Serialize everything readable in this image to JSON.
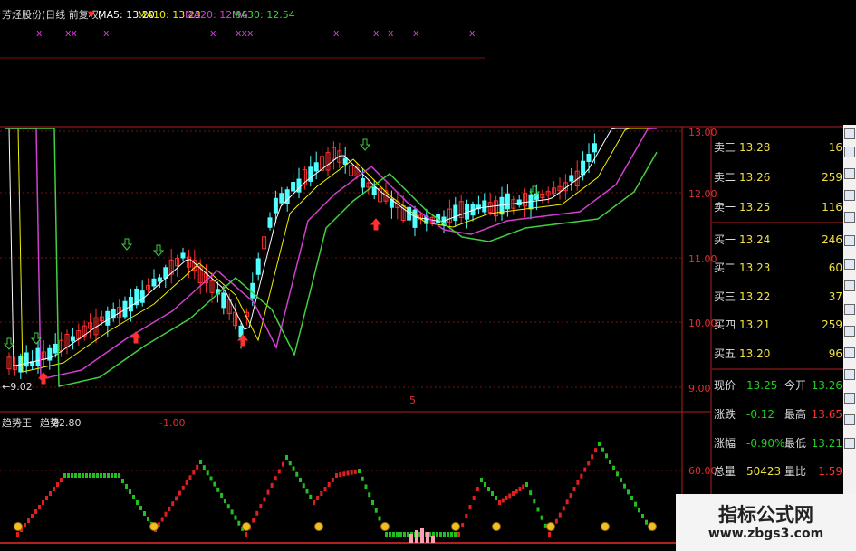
{
  "header": {
    "stock_name": "芳烃股份(日线 前复权)",
    "ma5": "MA5: 13.20",
    "ma10": "MA10: 13.23",
    "ma20": "MA20: 12.96",
    "ma30": "MA30: 12.54"
  },
  "x_markers": [
    "x",
    "xx",
    "x",
    "xxx",
    "x",
    "x",
    "x",
    "x",
    "x",
    "x"
  ],
  "price_axis": [
    "13.00",
    "12.00",
    "11.00",
    "10.00",
    "9.00"
  ],
  "low_label": "←9.02",
  "bottom_marker": "5",
  "indicator": {
    "name": "趋势王",
    "label": "趋势",
    "value": "22.80",
    "ref_value": "-1.00",
    "axis_label": "60.00"
  },
  "order_book": {
    "sell": [
      {
        "label": "卖三",
        "price": "13.28",
        "vol": "16"
      },
      {
        "label": "卖二",
        "price": "13.26",
        "vol": "259"
      },
      {
        "label": "卖一",
        "price": "13.25",
        "vol": "116"
      }
    ],
    "buy": [
      {
        "label": "买一",
        "price": "13.24",
        "vol": "246"
      },
      {
        "label": "买二",
        "price": "13.23",
        "vol": "60"
      },
      {
        "label": "买三",
        "price": "13.22",
        "vol": "37"
      },
      {
        "label": "买四",
        "price": "13.21",
        "vol": "259"
      },
      {
        "label": "买五",
        "price": "13.20",
        "vol": "96"
      }
    ]
  },
  "quote_info": [
    {
      "l1": "现价",
      "v1": "13.25",
      "l2": "今开",
      "v2": "13.26"
    },
    {
      "l1": "涨跌",
      "v1": "-0.12",
      "l2": "最高",
      "v2": "13.65"
    },
    {
      "l1": "涨幅",
      "v1": "-0.90%",
      "l2": "最低",
      "v2": "13.21"
    },
    {
      "l1": "总量",
      "v1": "50423",
      "l2": "量比",
      "v2": "1.59"
    }
  ],
  "watermark": {
    "title": "指标公式网",
    "url": "www.zbgs3.com"
  },
  "colors": {
    "up": "#ff3030",
    "down": "#50ffff",
    "ma5": "#ffffff",
    "ma10": "#f0f000",
    "ma20": "#d040d0",
    "ma30": "#40d040",
    "gridline": "#7a1010",
    "indicator_up": "#e02020",
    "indicator_down": "#20c020"
  }
}
